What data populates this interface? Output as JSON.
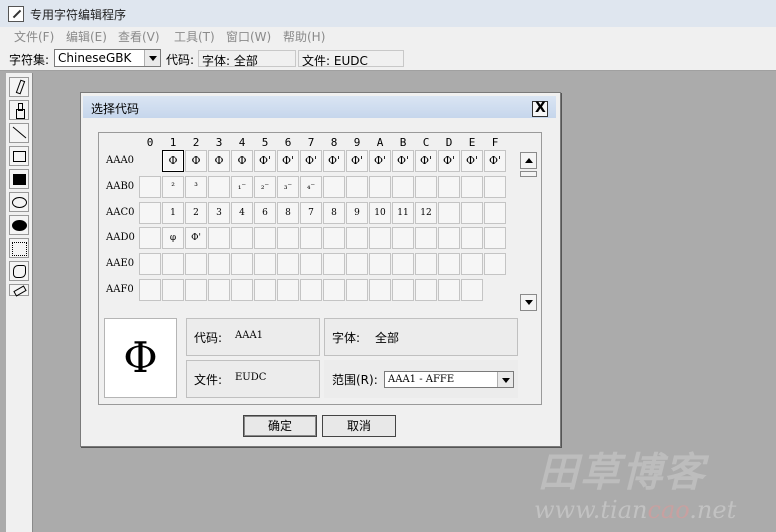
{
  "window": {
    "title": "专用字符编辑程序"
  },
  "menu": {
    "file": "文件(F)",
    "edit": "编辑(E)",
    "view": "查看(V)",
    "tools": "工具(T)",
    "window": "窗口(W)",
    "help": "帮助(H)"
  },
  "toolbar": {
    "charset_label": "字符集:",
    "charset_value": "ChineseGBK",
    "code_label": "代码:",
    "font_field": "字体: 全部",
    "file_field": "文件: EUDC"
  },
  "tools": [
    "pencil-icon",
    "brush-icon",
    "line-icon",
    "rect-hollow-icon",
    "rect-filled-icon",
    "ellipse-hollow-icon",
    "ellipse-filled-icon",
    "select-rect-icon",
    "select-free-icon",
    "eraser-icon"
  ],
  "dialog": {
    "title": "选择代码",
    "close": "X",
    "col_headers": [
      "0",
      "1",
      "2",
      "3",
      "4",
      "5",
      "6",
      "7",
      "8",
      "9",
      "A",
      "B",
      "C",
      "D",
      "E",
      "F"
    ],
    "rows": [
      {
        "label": "AAA0",
        "cells": [
          "",
          "Φ",
          "Φ",
          "Φ",
          "Φ",
          "Φ'",
          "Φ'",
          "Φ'",
          "Φ'",
          "Φ'",
          "Φ'",
          "Φ'",
          "Φ'",
          "Φ'",
          "Φ'",
          "Φ'"
        ]
      },
      {
        "label": "AAB0",
        "cells": [
          "",
          "²",
          "³",
          "",
          "₁⁻",
          "₂⁻",
          "₃⁻",
          "₄⁻",
          "",
          "",
          "",
          "",
          "",
          "",
          "",
          ""
        ]
      },
      {
        "label": "AAC0",
        "cells": [
          "",
          "1",
          "2",
          "3",
          "4",
          "6",
          "8",
          "7",
          "8",
          "9",
          "10",
          "11",
          "12",
          "",
          "",
          ""
        ]
      },
      {
        "label": "AAD0",
        "cells": [
          "",
          "φ",
          "Φ'",
          "",
          "",
          "",
          "",
          "",
          "",
          "",
          "",
          "",
          "",
          "",
          "",
          ""
        ]
      },
      {
        "label": "AAE0",
        "cells": [
          "",
          "",
          "",
          "",
          "",
          "",
          "",
          "",
          "",
          "",
          "",
          "",
          "",
          "",
          "",
          ""
        ]
      },
      {
        "label": "AAF0",
        "cells": [
          "",
          "",
          "",
          "",
          "",
          "",
          "",
          "",
          "",
          "",
          "",
          "",
          "",
          "",
          ""
        ]
      }
    ],
    "preview_char": "Φ",
    "code_label": "代码:",
    "code_value": "AAA1",
    "font_label": "字体:",
    "font_value": "全部",
    "file_label": "文件:",
    "file_value": "EUDC",
    "range_label": "范围(R):",
    "range_value": "AAA1 - AFFE",
    "ok": "确定",
    "cancel": "取消"
  },
  "watermark": {
    "brand": "田草博客",
    "site_a": "www.tian",
    "site_b": "cao",
    "site_c": ".net"
  }
}
